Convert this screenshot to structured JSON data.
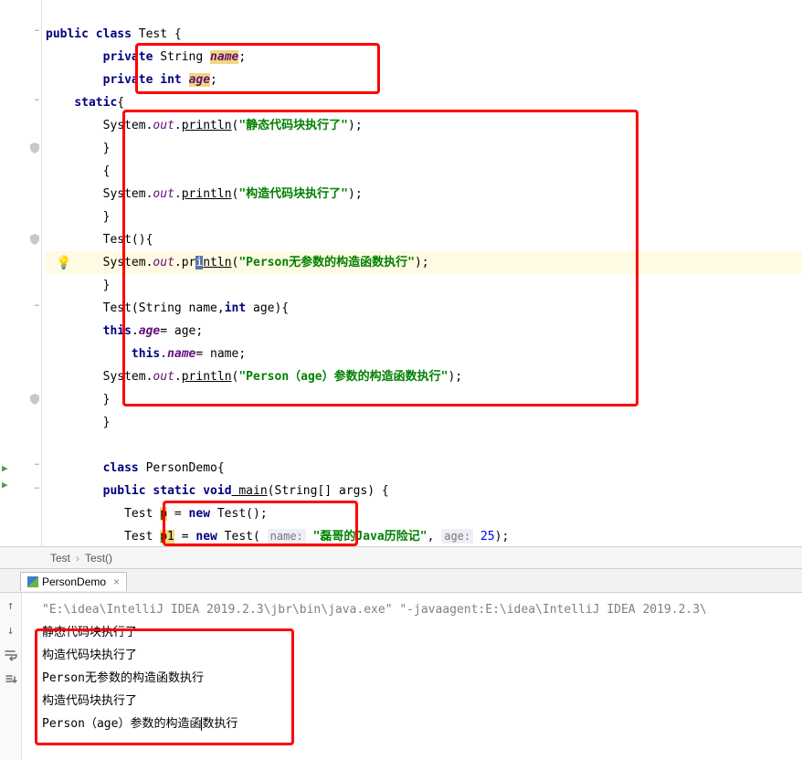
{
  "breadcrumb": {
    "item1": "Test",
    "item2": "Test()"
  },
  "run_tab": {
    "name": "PersonDemo"
  },
  "code": {
    "l1_public": "public",
    "l1_class": "class",
    "l1_test": " Test {",
    "l2_private": "private",
    "l2_string": " String ",
    "l2_name": "name",
    "l2_end": ";",
    "l3_private": "private",
    "l3_int": " int ",
    "l3_age": "age",
    "l3_end": ";",
    "l4_static": "static",
    "l4_brace": "{",
    "l5_sys": "System.",
    "l5_out": "out",
    "l5_dot": ".",
    "l5_println": "println",
    "l5_paren": "(",
    "l5_str": "\"静态代码块执行了\"",
    "l5_end": ");",
    "l6_brace": "}",
    "l7_brace": "{",
    "l8_sys": "System.",
    "l8_out": "out",
    "l8_dot": ".",
    "l8_println": "println",
    "l8_paren": "(",
    "l8_str": "\"构造代码块执行了\"",
    "l8_end": ");",
    "l9_brace": "}",
    "l10_test": "Test(){",
    "l11_sys": "System.",
    "l11_out": "out",
    "l11_dot": ".pr",
    "l11_i": "i",
    "l11_ntln": "ntln",
    "l11_paren": "(",
    "l11_str": "\"Person无参数的构造函数执行\"",
    "l11_end": ");",
    "l12_brace": "}",
    "l13_test": "Test(String name,",
    "l13_int": "int",
    "l13_rest": " age){",
    "l14_this": "this",
    "l14_dot": ".",
    "l14_age": "age",
    "l14_rest": "= age;",
    "l15_this": "this",
    "l15_dot": ".",
    "l15_name": "name",
    "l15_rest": "= name;",
    "l16_sys": "System.",
    "l16_out": "out",
    "l16_dot": ".",
    "l16_println": "println",
    "l16_paren": "(",
    "l16_str": "\"Person（age）参数的构造函数执行\"",
    "l16_end": ");",
    "l17_brace": "}",
    "l18_brace": "}",
    "l20_class": "class",
    "l20_rest": " PersonDemo{",
    "l21_public": "public",
    "l21_static": " static",
    "l21_void": " void",
    "l21_main": " main",
    "l21_rest": "(String[] args) {",
    "l22_test": "Test ",
    "l22_p": "p",
    "l22_eq": " = ",
    "l22_new": "new",
    "l22_rest": " Test();",
    "l23_test": "Test ",
    "l23_p1": "p1",
    "l23_eq": " = ",
    "l23_new": "new",
    "l23_testopen": " Test( ",
    "l23_hint1": "name:",
    "l23_str": " \"磊哥的Java历险记\"",
    "l23_comma": ", ",
    "l23_hint2": "age:",
    "l23_num": " 25",
    "l23_end": ");"
  },
  "console": {
    "cmd": "\"E:\\idea\\IntelliJ IDEA 2019.2.3\\jbr\\bin\\java.exe\" \"-javaagent:E:\\idea\\IntelliJ IDEA 2019.2.3\\",
    "o1": "静态代码块执行了",
    "o2": "构造代码块执行了",
    "o3": "Person无参数的构造函数执行",
    "o4": "构造代码块执行了",
    "o5_a": "Person（age）参数的构造函",
    "o5_b": "数执行"
  }
}
